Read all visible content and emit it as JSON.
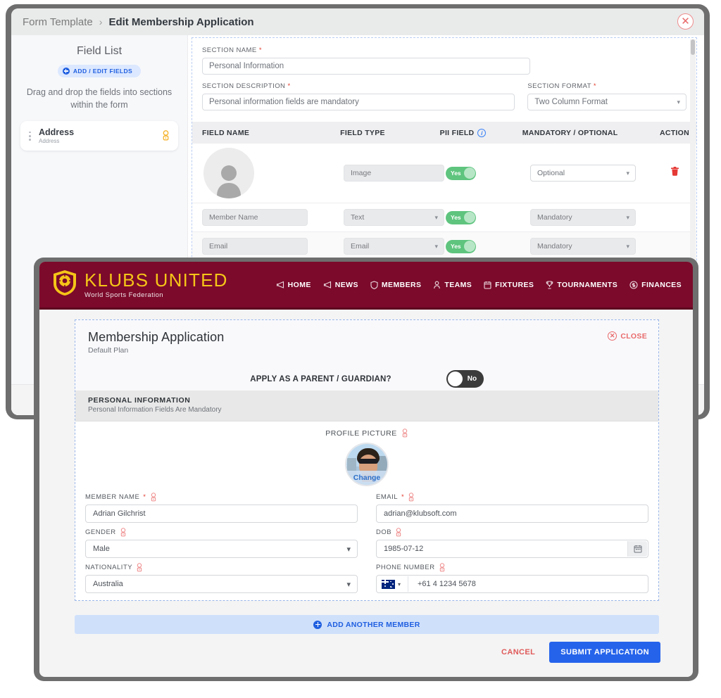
{
  "background_window": {
    "breadcrumb": {
      "root": "Form Template",
      "separator": "›",
      "current": "Edit Membership Application"
    },
    "close_icon": "✕",
    "field_list": {
      "title": "Field List",
      "add_edit_label": "ADD / EDIT FIELDS",
      "hint": "Drag and drop the fields into sections within the form",
      "items": [
        {
          "title": "Address",
          "subtitle": "Address",
          "pii_icon": "pii-fingerprint-icon"
        }
      ]
    },
    "section": {
      "name_label": "SECTION NAME",
      "name_value": "Personal Information",
      "description_label": "SECTION DESCRIPTION",
      "description_value": "Personal information fields are mandatory",
      "format_label": "SECTION FORMAT",
      "format_value": "Two Column Format",
      "required_mark": "*"
    },
    "table": {
      "columns": [
        "FIELD NAME",
        "FIELD TYPE",
        "PII FIELD",
        "MANDATORY / OPTIONAL",
        "ACTION"
      ],
      "pii_info_icon": "info-icon",
      "rows": [
        {
          "field_name": "",
          "field_name_is_avatar": true,
          "field_type": "Image",
          "pii": "Yes",
          "mandatory": "Optional",
          "action": "delete-icon"
        },
        {
          "field_name": "Member Name",
          "field_name_is_avatar": false,
          "field_type": "Text",
          "pii": "Yes",
          "mandatory": "Mandatory",
          "action": ""
        },
        {
          "field_name": "Email",
          "field_name_is_avatar": false,
          "field_type": "Email",
          "pii": "Yes",
          "mandatory": "Mandatory",
          "action": ""
        }
      ]
    }
  },
  "site": {
    "brand": {
      "name": "KLUBS UNITED",
      "tagline": "World Sports Federation",
      "logo_icon": "shield-soccer-logo-icon"
    },
    "nav": [
      {
        "label": "HOME",
        "icon": "megaphone-icon"
      },
      {
        "label": "NEWS",
        "icon": "megaphone-icon"
      },
      {
        "label": "MEMBERS",
        "icon": "shield-icon"
      },
      {
        "label": "TEAMS",
        "icon": "people-icon"
      },
      {
        "label": "FIXTURES",
        "icon": "calendar-icon"
      },
      {
        "label": "TOURNAMENTS",
        "icon": "trophy-icon"
      },
      {
        "label": "FINANCES",
        "icon": "dollar-icon"
      }
    ]
  },
  "application": {
    "title": "Membership Application",
    "subtitle": "Default Plan",
    "close_label": "CLOSE",
    "close_icon": "✕",
    "guardian_question": "APPLY AS A PARENT / GUARDIAN?",
    "guardian_toggle_value": "No",
    "section_title": "PERSONAL INFORMATION",
    "section_subtitle": "Personal Information Fields Are Mandatory",
    "profile_picture": {
      "label": "PROFILE PICTURE",
      "change_label": "Change",
      "pii_icon": "pii-fingerprint-icon"
    },
    "fields": [
      {
        "label": "MEMBER NAME",
        "required": "*",
        "value": "Adrian Gilchrist",
        "type": "text",
        "pii_icon": "pii-fingerprint-icon"
      },
      {
        "label": "EMAIL",
        "required": "*",
        "value": "adrian@klubsoft.com",
        "type": "text",
        "pii_icon": "pii-fingerprint-icon"
      },
      {
        "label": "GENDER",
        "required": "",
        "value": "Male",
        "type": "select",
        "pii_icon": "pii-fingerprint-icon"
      },
      {
        "label": "DOB",
        "required": "",
        "value": "1985-07-12",
        "type": "date",
        "pii_icon": "pii-fingerprint-icon"
      },
      {
        "label": "NATIONALITY",
        "required": "",
        "value": "Australia",
        "type": "select",
        "pii_icon": "pii-fingerprint-icon"
      },
      {
        "label": "PHONE NUMBER",
        "required": "",
        "value": "+61 4 1234 5678",
        "type": "phone",
        "flag": "australia-flag-icon",
        "pii_icon": "pii-fingerprint-icon"
      }
    ],
    "add_member_label": "ADD ANOTHER MEMBER",
    "cancel_label": "CANCEL",
    "submit_label": "SUBMIT APPLICATION"
  },
  "colors": {
    "brand_maroon": "#7b0a2b",
    "brand_yellow": "#f5c518",
    "accent_blue": "#2563eb",
    "danger_red": "#e05a5a",
    "toggle_green": "#5ec47e"
  }
}
